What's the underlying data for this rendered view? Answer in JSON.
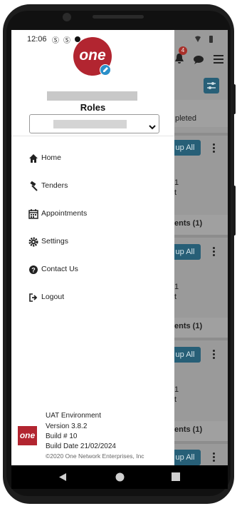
{
  "status_bar": {
    "time": "12:06"
  },
  "drawer": {
    "roles_label": "Roles",
    "menu": [
      {
        "label": "Home",
        "icon": "home-icon"
      },
      {
        "label": "Tenders",
        "icon": "gavel-icon"
      },
      {
        "label": "Appointments",
        "icon": "calendar-icon"
      },
      {
        "label": "Settings",
        "icon": "gear-icon"
      },
      {
        "label": "Contact Us",
        "icon": "question-circle-icon"
      },
      {
        "label": "Logout",
        "icon": "logout-icon"
      }
    ],
    "footer": {
      "logo_text": "one",
      "environment": "UAT Environment",
      "version": "Version 3.8.2",
      "build": "Build # 10",
      "build_date": "Build Date 21/02/2024",
      "copyright": "©2020 One Network Enterprises, Inc"
    }
  },
  "background": {
    "notification_count": "4",
    "status_text": "pleted",
    "cards": [
      {
        "button": "up All",
        "section": "ents (1)",
        "line1": "1",
        "line2": "t"
      },
      {
        "button": "up All",
        "section": "ents (1)",
        "line1": "1",
        "line2": "t"
      },
      {
        "button": "up All",
        "section": "ents (1)",
        "line1": "1",
        "line2": "t"
      },
      {
        "button": "up All",
        "section": "",
        "line1": "",
        "line2": ""
      }
    ]
  },
  "colors": {
    "brand_red": "#b22530",
    "accent_teal": "#2b6f8b"
  }
}
